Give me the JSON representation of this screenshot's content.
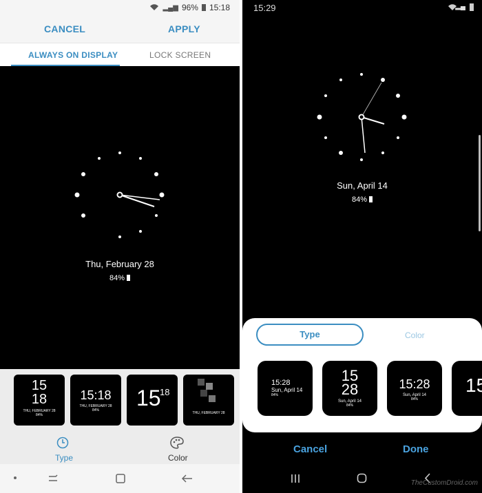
{
  "left": {
    "status": {
      "battery_pct": "96%",
      "time": "15:18"
    },
    "header": {
      "cancel_label": "CANCEL",
      "apply_label": "APPLY"
    },
    "tabs": {
      "active_label": "ALWAYS ON DISPLAY",
      "inactive_label": "LOCK SCREEN"
    },
    "preview": {
      "date": "Thu, February 28",
      "battery": "84%"
    },
    "thumbnails": [
      {
        "hour": "15",
        "minute": "18",
        "date": "THU, FEBRUARY 28",
        "battery": "84%"
      },
      {
        "time": "15:18",
        "date": "THU, FEBRUARY 28",
        "battery": "84%"
      },
      {
        "hour": "15",
        "minute": "18"
      },
      {
        "time": "15",
        "date": "THU, FEBRUARY 28",
        "battery": "84%"
      }
    ],
    "options": {
      "type_label": "Type",
      "color_label": "Color"
    }
  },
  "right": {
    "status": {
      "time": "15:29"
    },
    "preview": {
      "date": "Sun, April 14",
      "battery": "84%"
    },
    "segments": {
      "type_label": "Type",
      "color_label": "Color"
    },
    "thumbnails": [
      {
        "time": "15:28",
        "date": "Sun, April 14",
        "battery": "84%"
      },
      {
        "hour": "15",
        "minute": "28",
        "date": "Sun, April 14",
        "battery": "84%"
      },
      {
        "time": "15:28",
        "date": "Sun, April 14",
        "battery": "84%"
      },
      {
        "hour": "15"
      }
    ],
    "actions": {
      "cancel_label": "Cancel",
      "done_label": "Done"
    },
    "watermark": "TheCustomDroid.com"
  },
  "colors": {
    "accent": "#3a8dc1",
    "accent_bright": "#4aa3e0",
    "background": "#000000"
  }
}
